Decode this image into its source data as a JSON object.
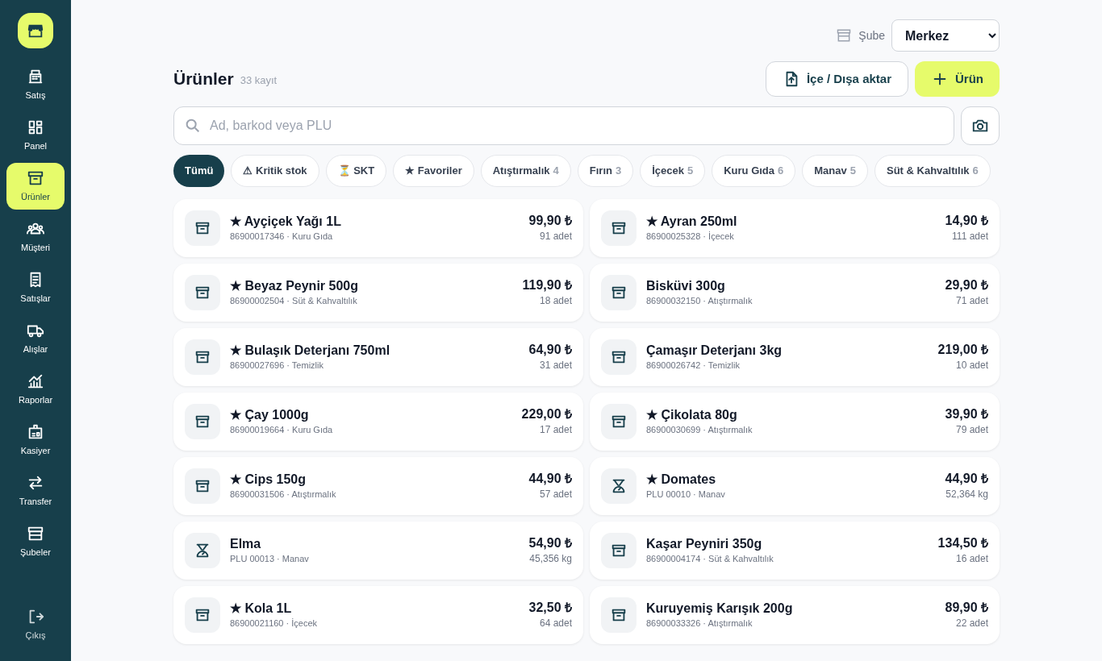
{
  "sidebar": {
    "items": [
      {
        "label": "Satış",
        "selected": false
      },
      {
        "label": "Panel",
        "selected": false
      },
      {
        "label": "Ürünler",
        "selected": true
      },
      {
        "label": "Müşteri",
        "selected": false
      },
      {
        "label": "Satışlar",
        "selected": false
      },
      {
        "label": "Alışlar",
        "selected": false
      },
      {
        "label": "Raporlar",
        "selected": false
      },
      {
        "label": "Kasiyer",
        "selected": false
      },
      {
        "label": "Transfer",
        "selected": false
      },
      {
        "label": "Şubeler",
        "selected": false
      }
    ],
    "logout": "Çıkış"
  },
  "branch": {
    "label": "Şube",
    "value": "Merkez"
  },
  "header": {
    "title": "Ürünler",
    "count": "33 kayıt",
    "buttons": [
      {
        "kind": "import",
        "label": "İçe / Dışa aktar"
      },
      {
        "kind": "add",
        "label": "Ürün"
      }
    ]
  },
  "search": {
    "placeholder": "Ad, barkod veya PLU"
  },
  "filters": [
    {
      "label": "Tümü",
      "selected": true
    },
    {
      "label": "⚠ Kritik stok",
      "selected": false
    },
    {
      "label": "⏳ SKT",
      "selected": false
    },
    {
      "label": "★ Favoriler",
      "selected": false
    },
    {
      "label": "Atıştırmalık",
      "count": "4",
      "selected": false
    },
    {
      "label": "Fırın",
      "count": "3",
      "selected": false
    },
    {
      "label": "İçecek",
      "count": "5",
      "selected": false
    },
    {
      "label": "Kuru Gıda",
      "count": "6",
      "selected": false
    },
    {
      "label": "Manav",
      "count": "5",
      "selected": false
    },
    {
      "label": "Süt & Kahvaltılık",
      "count": "6",
      "selected": false
    }
  ],
  "products": [
    {
      "kind": "packaged",
      "name": "★ Ayçiçek Yağı 1L",
      "details": "86900017346 · Kuru Gıda",
      "price": "99,90 ₺",
      "stock": "91 adet"
    },
    {
      "kind": "packaged",
      "name": "★ Ayran 250ml",
      "details": "86900025328 · İçecek",
      "price": "14,90 ₺",
      "stock": "111 adet"
    },
    {
      "kind": "packaged",
      "name": "★ Beyaz Peynir 500g",
      "details": "86900002504 · Süt & Kahvaltılık",
      "price": "119,90 ₺",
      "stock": "18 adet"
    },
    {
      "kind": "packaged",
      "name": "Bisküvi 300g",
      "details": "86900032150 · Atıştırmalık",
      "price": "29,90 ₺",
      "stock": "71 adet"
    },
    {
      "kind": "packaged",
      "name": "★ Bulaşık Deterjanı 750ml",
      "details": "86900027696 · Temizlik",
      "price": "64,90 ₺",
      "stock": "31 adet"
    },
    {
      "kind": "packaged",
      "name": "Çamaşır Deterjanı 3kg",
      "details": "86900026742 · Temizlik",
      "price": "219,00 ₺",
      "stock": "10 adet"
    },
    {
      "kind": "packaged",
      "name": "★ Çay 1000g",
      "details": "86900019664 · Kuru Gıda",
      "price": "229,00 ₺",
      "stock": "17 adet"
    },
    {
      "kind": "packaged",
      "name": "★ Çikolata 80g",
      "details": "86900030699 · Atıştırmalık",
      "price": "39,90 ₺",
      "stock": "79 adet"
    },
    {
      "kind": "packaged",
      "name": "★ Cips 150g",
      "details": "86900031506 · Atıştırmalık",
      "price": "44,90 ₺",
      "stock": "57 adet"
    },
    {
      "kind": "weighed",
      "name": "★ Domates",
      "details": "PLU 00010 · Manav",
      "price": "44,90 ₺",
      "stock": "52,364 kg"
    },
    {
      "kind": "weighed",
      "name": "Elma",
      "details": "PLU 00013 · Manav",
      "price": "54,90 ₺",
      "stock": "45,356 kg"
    },
    {
      "kind": "packaged",
      "name": "Kaşar Peyniri 350g",
      "details": "86900004174 · Süt & Kahvaltılık",
      "price": "134,50 ₺",
      "stock": "16 adet"
    },
    {
      "kind": "packaged",
      "name": "★ Kola 1L",
      "details": "86900021160 · İçecek",
      "price": "32,50 ₺",
      "stock": "64 adet"
    },
    {
      "kind": "packaged",
      "name": "Kuruyemiş Karışık 200g",
      "details": "86900033326 · Atıştırmalık",
      "price": "89,90 ₺",
      "stock": "22 adet"
    }
  ]
}
